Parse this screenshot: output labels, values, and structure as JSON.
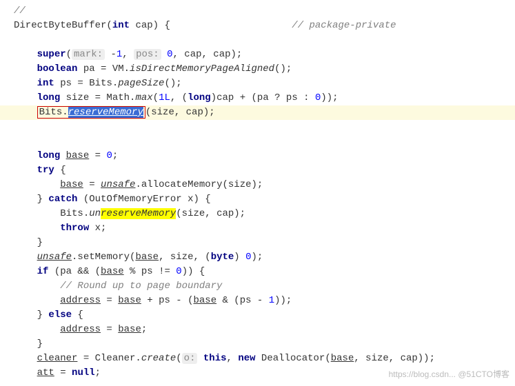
{
  "code": {
    "l1": "//",
    "l2a": "DirectByteBuffer(",
    "l2b": "int",
    "l2c": " cap) {",
    "l2cmt": "// package-private",
    "l3a": "super",
    "l3b": "(",
    "l3hint1": "mark:",
    "l3c": " -",
    "l3num1": "1",
    "l3d": ", ",
    "l3hint2": "pos:",
    "l3e": " ",
    "l3num2": "0",
    "l3f": ", cap, cap);",
    "l4a": "boolean",
    "l4b": " pa = VM.",
    "l4c": "isDirectMemoryPageAligned",
    "l4d": "();",
    "l5a": "int",
    "l5b": " ps = Bits.",
    "l5c": "pageSize",
    "l5d": "();",
    "l6a": "long",
    "l6b": " size = Math.",
    "l6c": "max",
    "l6d": "(",
    "l6num1": "1L",
    "l6e": ", (",
    "l6f": "long",
    "l6g": ")cap + (pa ? ps : ",
    "l6num2": "0",
    "l6h": "));",
    "l7a": "Bits.",
    "l7sel": "reserveMemory",
    "l7b": "(size, cap);",
    "l8a": "long",
    "l8b": " ",
    "l8c": "base",
    "l8d": " = ",
    "l8num": "0",
    "l8e": ";",
    "l9a": "try",
    "l9b": " {",
    "l10a": "base",
    "l10b": " = ",
    "l10c": "unsafe",
    "l10d": ".allocateMemory(size);",
    "l11a": "} ",
    "l11b": "catch",
    "l11c": " (OutOfMemoryError x) {",
    "l12a": "Bits.",
    "l12b": "un",
    "l12hl": "reserveMemory",
    "l12c": "(size, cap);",
    "l13a": "throw",
    "l13b": " x;",
    "l14": "}",
    "l15a": "unsafe",
    "l15b": ".setMemory(",
    "l15c": "base",
    "l15d": ", size, (",
    "l15e": "byte",
    "l15f": ") ",
    "l15num": "0",
    "l15g": ");",
    "l16a": "if",
    "l16b": " (pa && (",
    "l16c": "base",
    "l16d": " % ps != ",
    "l16num": "0",
    "l16e": ")) {",
    "l17": "// Round up to page boundary",
    "l18a": "address",
    "l18b": " = ",
    "l18c": "base",
    "l18d": " + ps - (",
    "l18e": "base",
    "l18f": " & (ps - ",
    "l18num": "1",
    "l18g": "));",
    "l19a": "} ",
    "l19b": "else",
    "l19c": " {",
    "l20a": "address",
    "l20b": " = ",
    "l20c": "base",
    "l20d": ";",
    "l21": "}",
    "l22a": "cleaner",
    "l22b": " = Cleaner.",
    "l22c": "create",
    "l22d": "(",
    "l22hint": "o:",
    "l22e": " ",
    "l22f": "this",
    "l22g": ", ",
    "l22h": "new",
    "l22i": " Deallocator(",
    "l22j": "base",
    "l22k": ", size, cap));",
    "l23a": "att",
    "l23b": " = ",
    "l23c": "null",
    "l23d": ";"
  },
  "watermark": "https://blog.csdn... @51CTO博客"
}
